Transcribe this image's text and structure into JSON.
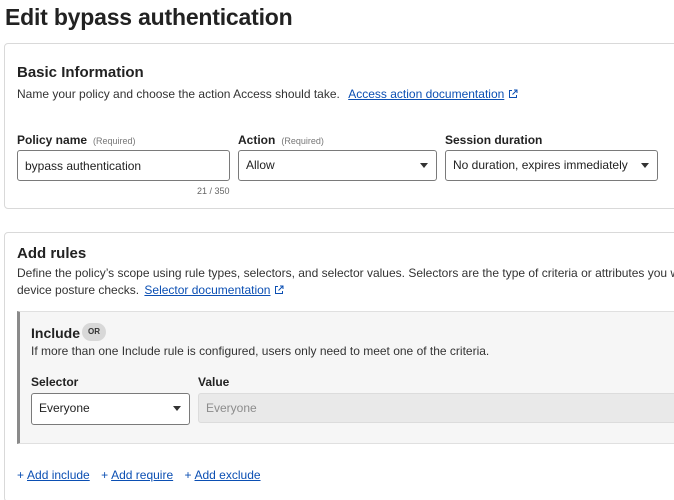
{
  "page": {
    "title": "Edit bypass authentication"
  },
  "basic": {
    "title": "Basic Information",
    "description": "Name your policy and choose the action Access should take.",
    "doc_link": "Access action documentation",
    "policy_name": {
      "label": "Policy name",
      "required": "(Required)",
      "value": "bypass authentication",
      "counter": "21 / 350"
    },
    "action": {
      "label": "Action",
      "required": "(Required)",
      "value": "Allow"
    },
    "session": {
      "label": "Session duration",
      "value": "No duration, expires immediately"
    }
  },
  "rules": {
    "title": "Add rules",
    "description_line1": "Define the policy’s scope using rule types, selectors, and selector values. Selectors are the type of criteria or attributes you want",
    "description_line2": "device posture checks.",
    "doc_link": "Selector documentation",
    "include": {
      "title": "Include",
      "badge": "OR",
      "description": "If more than one Include rule is configured, users only need to meet one of the criteria.",
      "selector_label": "Selector",
      "selector_value": "Everyone",
      "value_label": "Value",
      "value_value": "Everyone"
    },
    "actions": {
      "add_include": "Add include",
      "add_require": "Add require",
      "add_exclude": "Add exclude",
      "plus": "+"
    }
  },
  "colors": {
    "link": "#0b4fb3",
    "include_border": "#8a8a8a"
  }
}
